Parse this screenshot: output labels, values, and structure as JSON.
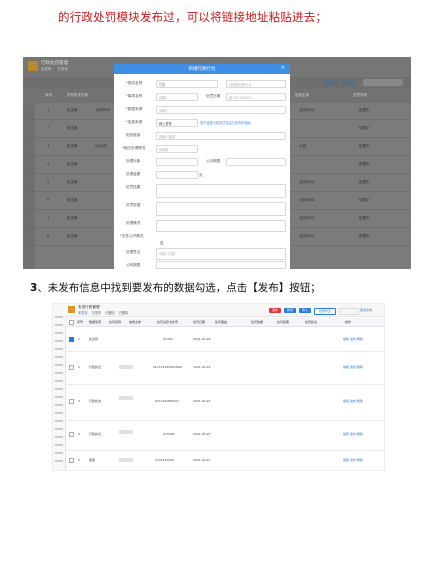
{
  "top_text": "的行政处罚模块发布过，可以将链接地址粘贴进去；",
  "caption": {
    "number": "3",
    "text": "、未发布信息中找到要发布的数据勾选，点击【发布】按钮；"
  },
  "modal": {
    "title": "新增行政行为",
    "close_symbol": "×",
    "fields": [
      {
        "label": "规范名称",
        "required": true,
        "value": "行政",
        "placeholder": "请选择行政行为"
      },
      {
        "label": "事项名称",
        "required": true,
        "placeholder": "请输入"
      },
      {
        "label": "数据来源",
        "required": true,
        "placeholder": "请输入"
      },
      {
        "label": "信息来源",
        "required": true,
        "value": "网上发布"
      },
      {
        "label": "相关链接",
        "placeholder": "请输入链接"
      },
      {
        "label": "相应处理情况",
        "required": true,
        "placeholder": "请选择"
      },
      {
        "label": "处理对象"
      },
      {
        "label": "处理金额"
      },
      {
        "label": "处罚结果"
      },
      {
        "label": "处罚依据"
      },
      {
        "label": "处理情况"
      },
      {
        "label": "文件公开情况"
      },
      {
        "label": "处理意见",
        "placeholder": "请输入内容"
      },
      {
        "label": "公布期限"
      }
    ],
    "second_col_labels": {
      "date": "处罚日期",
      "deadline": "公示期限"
    },
    "date_placeholder": "如 2021/05/03",
    "link_note": "用于链接行政处罚信息已发布的地址",
    "unit": "元",
    "suffix_value": "否"
  },
  "shot1": {
    "app_name": "行政处罚管理",
    "tabs": [
      "未发布",
      "已发布"
    ],
    "headers": [
      "序号",
      "发布机关名称",
      "信用主体",
      "处罚名称",
      "操作"
    ],
    "rows": [
      {
        "no": "1",
        "org": "执法局",
        "subject": "北京市XX",
        "action": "处理中"
      },
      {
        "no": "2",
        "org": "执法局",
        "subject": "",
        "action": "处理中"
      },
      {
        "no": "3",
        "org": "执法局",
        "subject": "XX公司",
        "action": "处理中"
      },
      {
        "no": "4",
        "org": "执法局",
        "subject": "",
        "action": "处理中"
      },
      {
        "no": "5",
        "org": "执法局",
        "subject": "",
        "action": "处理中"
      },
      {
        "no": "6",
        "org": "执法局",
        "subject": "",
        "action": "处理中"
      },
      {
        "no": "7",
        "org": "执法局",
        "subject": "",
        "action": "处理中"
      },
      {
        "no": "8",
        "org": "执法局",
        "subject": "",
        "action": "处理中"
      }
    ],
    "right_cells": [
      "北京市XX",
      "",
      "公司",
      "",
      "北京市XX",
      "北京市XX",
      "北京市XX",
      "北京市XX"
    ]
  },
  "shot2": {
    "app_name": "未发行政管理",
    "tabs": [
      "未发布",
      "已发布",
      "已撤回",
      "已删除"
    ],
    "buttons": {
      "publish": "发布",
      "add": "新增",
      "import": "导入",
      "export": "批量导出"
    },
    "more": "更多查询",
    "headers": [
      "序号",
      "数据来源",
      "处罚名称",
      "信用主体",
      "处罚决定书文号",
      "处罚日期",
      "处罚事由",
      "处罚依据",
      "处罚结果",
      "处罚机关",
      "操作"
    ],
    "rows": [
      {
        "no": "1",
        "source": "执法局",
        "doc": "91350",
        "date": "2021-03-18",
        "checked": true
      },
      {
        "no": "2",
        "source": "行政执法",
        "doc": "911101234567890",
        "date": "2021-03-19",
        "checked": false
      },
      {
        "no": "3",
        "source": "行政执法",
        "doc": "91110108MA01",
        "date": "2021-03-22",
        "checked": false
      },
      {
        "no": "4",
        "source": "行政执法",
        "doc": "115006",
        "date": "2021-03-25",
        "checked": false
      },
      {
        "no": "5",
        "source": "其他",
        "doc": "1101231000",
        "date": "2021-03-27",
        "checked": false
      }
    ],
    "op_labels": "编辑 发布 删除"
  }
}
